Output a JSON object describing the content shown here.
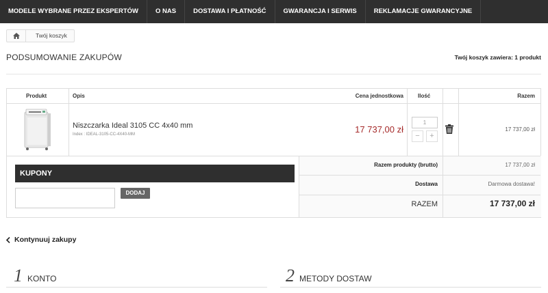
{
  "nav": {
    "items": [
      "MODELE WYBRANE PRZEZ EKSPERTÓW",
      "O NAS",
      "DOSTAWA I PŁATNOŚĆ",
      "GWARANCJA I SERWIS",
      "REKLAMACJE GWARANCYJNE"
    ]
  },
  "breadcrumb": {
    "current": "Twój koszyk"
  },
  "summary": {
    "title": "PODSUMOWANIE ZAKUPÓW",
    "cart_count": "Twój koszyk zawiera: 1 produkt"
  },
  "table": {
    "headers": {
      "product": "Produkt",
      "description": "Opis",
      "unit_price": "Cena jednostkowa",
      "qty": "Ilość",
      "total": "Razem"
    },
    "item": {
      "name": "Niszczarka Ideal 3105 CC 4x40 mm",
      "index": "Index : IDEAL-3105-CC-4X40-MM",
      "unit_price": "17 737,00 zł",
      "quantity": "1",
      "minus": "−",
      "plus": "+",
      "total": "17 737,00 zł"
    }
  },
  "coupons": {
    "title": "KUPONY",
    "input_value": "",
    "button": "DODAJ"
  },
  "totals": {
    "products_label": "Razem produkty (brutto)",
    "products_value": "17 737,00 zł",
    "shipping_label": "Dostawa",
    "shipping_value": "Darmowa dostawa!",
    "grand_label": "RAZEM",
    "grand_value": "17 737,00 zł"
  },
  "continue_label": "Kontynuuj zakupy",
  "steps": [
    {
      "num": "1",
      "label": "KONTO"
    },
    {
      "num": "2",
      "label": "METODY DOSTAW"
    }
  ],
  "colors": {
    "nav_bg": "#2f2f2f",
    "price_red": "#a52a2a",
    "coupon_button": "#666666"
  }
}
